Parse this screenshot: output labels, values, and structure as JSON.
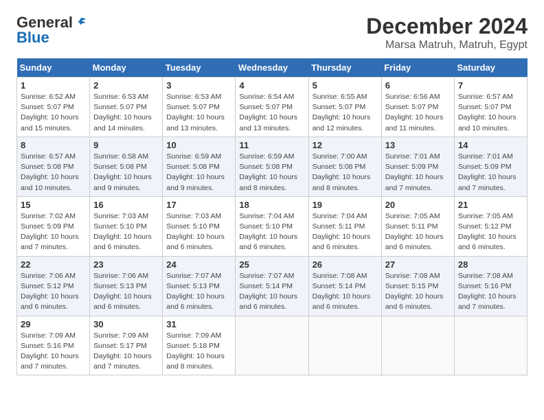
{
  "header": {
    "logo_general": "General",
    "logo_blue": "Blue",
    "month_title": "December 2024",
    "location": "Marsa Matruh, Matruh, Egypt"
  },
  "weekdays": [
    "Sunday",
    "Monday",
    "Tuesday",
    "Wednesday",
    "Thursday",
    "Friday",
    "Saturday"
  ],
  "weeks": [
    [
      {
        "day": "1",
        "sunrise": "6:52 AM",
        "sunset": "5:07 PM",
        "daylight": "10 hours and 15 minutes."
      },
      {
        "day": "2",
        "sunrise": "6:53 AM",
        "sunset": "5:07 PM",
        "daylight": "10 hours and 14 minutes."
      },
      {
        "day": "3",
        "sunrise": "6:53 AM",
        "sunset": "5:07 PM",
        "daylight": "10 hours and 13 minutes."
      },
      {
        "day": "4",
        "sunrise": "6:54 AM",
        "sunset": "5:07 PM",
        "daylight": "10 hours and 13 minutes."
      },
      {
        "day": "5",
        "sunrise": "6:55 AM",
        "sunset": "5:07 PM",
        "daylight": "10 hours and 12 minutes."
      },
      {
        "day": "6",
        "sunrise": "6:56 AM",
        "sunset": "5:07 PM",
        "daylight": "10 hours and 11 minutes."
      },
      {
        "day": "7",
        "sunrise": "6:57 AM",
        "sunset": "5:07 PM",
        "daylight": "10 hours and 10 minutes."
      }
    ],
    [
      {
        "day": "8",
        "sunrise": "6:57 AM",
        "sunset": "5:08 PM",
        "daylight": "10 hours and 10 minutes."
      },
      {
        "day": "9",
        "sunrise": "6:58 AM",
        "sunset": "5:08 PM",
        "daylight": "10 hours and 9 minutes."
      },
      {
        "day": "10",
        "sunrise": "6:59 AM",
        "sunset": "5:08 PM",
        "daylight": "10 hours and 9 minutes."
      },
      {
        "day": "11",
        "sunrise": "6:59 AM",
        "sunset": "5:08 PM",
        "daylight": "10 hours and 8 minutes."
      },
      {
        "day": "12",
        "sunrise": "7:00 AM",
        "sunset": "5:08 PM",
        "daylight": "10 hours and 8 minutes."
      },
      {
        "day": "13",
        "sunrise": "7:01 AM",
        "sunset": "5:09 PM",
        "daylight": "10 hours and 7 minutes."
      },
      {
        "day": "14",
        "sunrise": "7:01 AM",
        "sunset": "5:09 PM",
        "daylight": "10 hours and 7 minutes."
      }
    ],
    [
      {
        "day": "15",
        "sunrise": "7:02 AM",
        "sunset": "5:09 PM",
        "daylight": "10 hours and 7 minutes."
      },
      {
        "day": "16",
        "sunrise": "7:03 AM",
        "sunset": "5:10 PM",
        "daylight": "10 hours and 6 minutes."
      },
      {
        "day": "17",
        "sunrise": "7:03 AM",
        "sunset": "5:10 PM",
        "daylight": "10 hours and 6 minutes."
      },
      {
        "day": "18",
        "sunrise": "7:04 AM",
        "sunset": "5:10 PM",
        "daylight": "10 hours and 6 minutes."
      },
      {
        "day": "19",
        "sunrise": "7:04 AM",
        "sunset": "5:11 PM",
        "daylight": "10 hours and 6 minutes."
      },
      {
        "day": "20",
        "sunrise": "7:05 AM",
        "sunset": "5:11 PM",
        "daylight": "10 hours and 6 minutes."
      },
      {
        "day": "21",
        "sunrise": "7:05 AM",
        "sunset": "5:12 PM",
        "daylight": "10 hours and 6 minutes."
      }
    ],
    [
      {
        "day": "22",
        "sunrise": "7:06 AM",
        "sunset": "5:12 PM",
        "daylight": "10 hours and 6 minutes."
      },
      {
        "day": "23",
        "sunrise": "7:06 AM",
        "sunset": "5:13 PM",
        "daylight": "10 hours and 6 minutes."
      },
      {
        "day": "24",
        "sunrise": "7:07 AM",
        "sunset": "5:13 PM",
        "daylight": "10 hours and 6 minutes."
      },
      {
        "day": "25",
        "sunrise": "7:07 AM",
        "sunset": "5:14 PM",
        "daylight": "10 hours and 6 minutes."
      },
      {
        "day": "26",
        "sunrise": "7:08 AM",
        "sunset": "5:14 PM",
        "daylight": "10 hours and 6 minutes."
      },
      {
        "day": "27",
        "sunrise": "7:08 AM",
        "sunset": "5:15 PM",
        "daylight": "10 hours and 6 minutes."
      },
      {
        "day": "28",
        "sunrise": "7:08 AM",
        "sunset": "5:16 PM",
        "daylight": "10 hours and 7 minutes."
      }
    ],
    [
      {
        "day": "29",
        "sunrise": "7:09 AM",
        "sunset": "5:16 PM",
        "daylight": "10 hours and 7 minutes."
      },
      {
        "day": "30",
        "sunrise": "7:09 AM",
        "sunset": "5:17 PM",
        "daylight": "10 hours and 7 minutes."
      },
      {
        "day": "31",
        "sunrise": "7:09 AM",
        "sunset": "5:18 PM",
        "daylight": "10 hours and 8 minutes."
      },
      null,
      null,
      null,
      null
    ]
  ]
}
